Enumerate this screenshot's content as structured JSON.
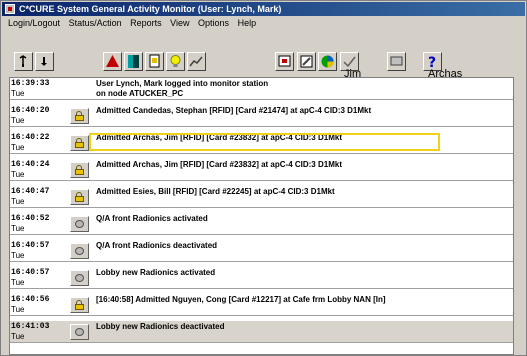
{
  "window": {
    "title": "C*CURE System General Activity Monitor (User: Lynch, Mark)"
  },
  "menu": [
    "Login/Logout",
    "Status/Action",
    "Reports",
    "View",
    "Options",
    "Help"
  ],
  "toolbar": {
    "buttons": [
      {
        "name": "pin-icon",
        "color": "#000000"
      },
      {
        "name": "download-icon",
        "color": "#000000"
      },
      {
        "name": "alarm-triangle-icon",
        "color": "#c00000"
      },
      {
        "name": "door-icon",
        "color": "#00a0a0"
      },
      {
        "name": "card-icon",
        "color": "#e0c000"
      },
      {
        "name": "lightbulb-icon",
        "color": "#e0e000"
      },
      {
        "name": "chart-icon",
        "color": "#808080"
      },
      {
        "name": "panel-icon",
        "color": "#c00000"
      },
      {
        "name": "edit-icon",
        "color": "#404040"
      },
      {
        "name": "color-wheel-icon",
        "color": "#00a000"
      },
      {
        "name": "check-icon",
        "color": "#606060"
      },
      {
        "name": "monitor-icon",
        "color": "#606060"
      },
      {
        "name": "help-icon",
        "color": "#0000c0"
      }
    ],
    "jim_label": "Jim",
    "archas_label": "Archas"
  },
  "log_rows": [
    {
      "time": "16:39:33",
      "day": "Tue",
      "icon": "none",
      "line1": "User Lynch, Mark logged into monitor station",
      "line2": "on node ATUCKER_PC"
    },
    {
      "time": "16:40:20",
      "day": "Tue",
      "icon": "lock",
      "line1": "Admitted Candedas, Stephan [RFID] [Card #21474] at  apC-4 CID:3 D1Mkt",
      "line2": ""
    },
    {
      "time": "16:40:22",
      "day": "Tue",
      "icon": "lock",
      "line1": "Admitted Archas, Jim [RFID] [Card #23832] at  apC-4 CID:3 D1Mkt",
      "line2": ""
    },
    {
      "time": "16:40:24",
      "day": "Tue",
      "icon": "lock",
      "line1": "Admitted Archas, Jim [RFID] [Card #23832] at  apC-4 CID:3 D1Mkt",
      "line2": ""
    },
    {
      "time": "16:40:47",
      "day": "Tue",
      "icon": "lock",
      "line1": "Admitted Esies, Bill [RFID] [Card #22245] at  apC-4 CID:3 D1Mkt",
      "line2": ""
    },
    {
      "time": "16:40:52",
      "day": "Tue",
      "icon": "dish",
      "line1": "Q/A front Radionics activated",
      "line2": ""
    },
    {
      "time": "16:40:57",
      "day": "Tue",
      "icon": "dish",
      "line1": "Q/A front Radionics deactivated",
      "line2": ""
    },
    {
      "time": "16:40:57",
      "day": "Tue",
      "icon": "dish",
      "line1": "Lobby new Radionics activated",
      "line2": ""
    },
    {
      "time": "16:40:56",
      "day": "Tue",
      "icon": "lock",
      "line1": "[16:40:58] Admitted Nguyen, Cong [Card #12217] at  Cafe frm Lobby NAN [In]",
      "line2": ""
    },
    {
      "time": "16:41:03",
      "day": "Tue",
      "icon": "dish",
      "line1": "Lobby new Radionics deactivated",
      "line2": ""
    }
  ],
  "highlight_color": "#f1d21b"
}
